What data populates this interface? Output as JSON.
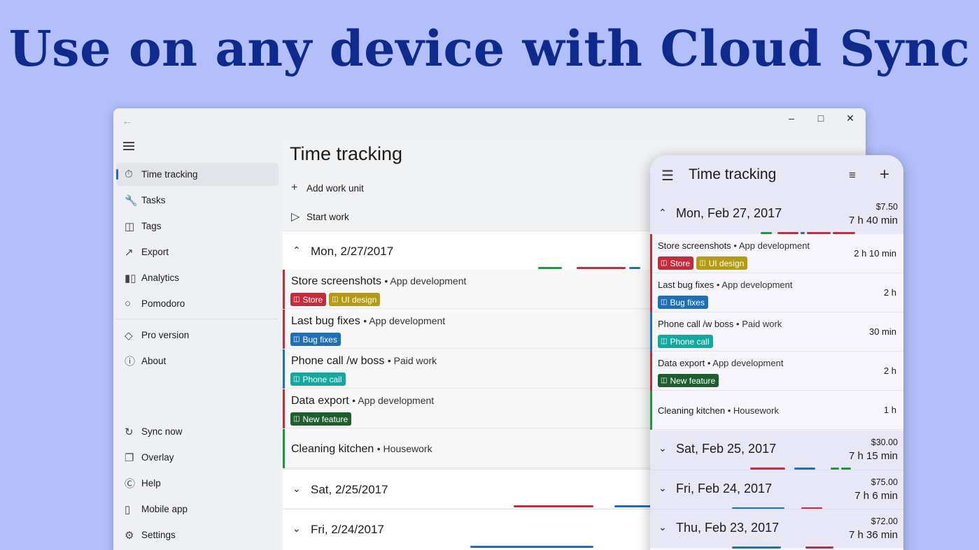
{
  "headline": "Use on any device with Cloud Sync",
  "colors": {
    "red": "#c42b3b",
    "olive": "#b59a14",
    "blue": "#1d6fb8",
    "teal": "#14a9a0",
    "green": "#1d5e2c",
    "stripe_green": "#1a9a3a",
    "stripe_blue": "#1873c8",
    "accent": "#2f61c6"
  },
  "desktop": {
    "sidebar": {
      "items": [
        {
          "label": "Time tracking",
          "icon": "stopwatch-icon"
        },
        {
          "label": "Tasks",
          "icon": "wrench-icon"
        },
        {
          "label": "Tags",
          "icon": "tag-icon"
        },
        {
          "label": "Export",
          "icon": "export-icon"
        },
        {
          "label": "Analytics",
          "icon": "analytics-icon"
        },
        {
          "label": "Pomodoro",
          "icon": "tomato-icon"
        },
        {
          "label": "Pro version",
          "icon": "diamond-icon"
        },
        {
          "label": "About",
          "icon": "info-icon"
        },
        {
          "label": "Sync now",
          "icon": "sync-icon"
        },
        {
          "label": "Overlay",
          "icon": "overlay-icon"
        },
        {
          "label": "Help",
          "icon": "help-icon"
        },
        {
          "label": "Mobile app",
          "icon": "mobile-icon"
        },
        {
          "label": "Settings",
          "icon": "gear-icon"
        }
      ]
    },
    "title": "Time tracking",
    "add_work_unit": "Add work unit",
    "start_work": "Start work",
    "days": [
      {
        "date": "Mon, 2/27/2017",
        "expanded": true
      },
      {
        "date": "Sat, 2/25/2017",
        "expanded": false
      },
      {
        "date": "Fri, 2/24/2017",
        "expanded": false
      }
    ],
    "work_units": [
      {
        "title": "Store screenshots",
        "project": "• App development",
        "tags": [
          "Store",
          "UI design"
        ]
      },
      {
        "title": "Last bug fixes",
        "project": "• App development",
        "tags": [
          "Bug fixes"
        ]
      },
      {
        "title": "Phone call /w boss",
        "project": "• Paid work",
        "tags": [
          "Phone call"
        ]
      },
      {
        "title": "Data export",
        "project": "• App development",
        "tags": [
          "New feature"
        ]
      },
      {
        "title": "Cleaning kitchen",
        "project": "• Housework",
        "tags": []
      }
    ]
  },
  "phone": {
    "title": "Time tracking",
    "days": [
      {
        "date": "Mon, Feb 27, 2017",
        "amount": "$7.50",
        "duration": "7 h 40 min"
      },
      {
        "date": "Sat, Feb 25, 2017",
        "amount": "$30.00",
        "duration": "7 h 15 min"
      },
      {
        "date": "Fri, Feb 24, 2017",
        "amount": "$75.00",
        "duration": "7 h 6 min"
      },
      {
        "date": "Thu, Feb 23, 2017",
        "amount": "$72.00",
        "duration": "7 h 36 min"
      }
    ],
    "work_units": [
      {
        "title": "Store screenshots",
        "project": "• App development",
        "tags": [
          "Store",
          "UI design"
        ],
        "duration": "2 h 10 min"
      },
      {
        "title": "Last bug fixes",
        "project": "• App development",
        "tags": [
          "Bug fixes"
        ],
        "duration": "2 h"
      },
      {
        "title": "Phone call /w boss",
        "project": "• Paid work",
        "tags": [
          "Phone call"
        ],
        "duration": "30 min"
      },
      {
        "title": "Data export",
        "project": "• App development",
        "tags": [
          "New feature"
        ],
        "duration": "2 h"
      },
      {
        "title": "Cleaning kitchen",
        "project": "• Housework",
        "tags": [],
        "duration": "1 h"
      }
    ]
  }
}
